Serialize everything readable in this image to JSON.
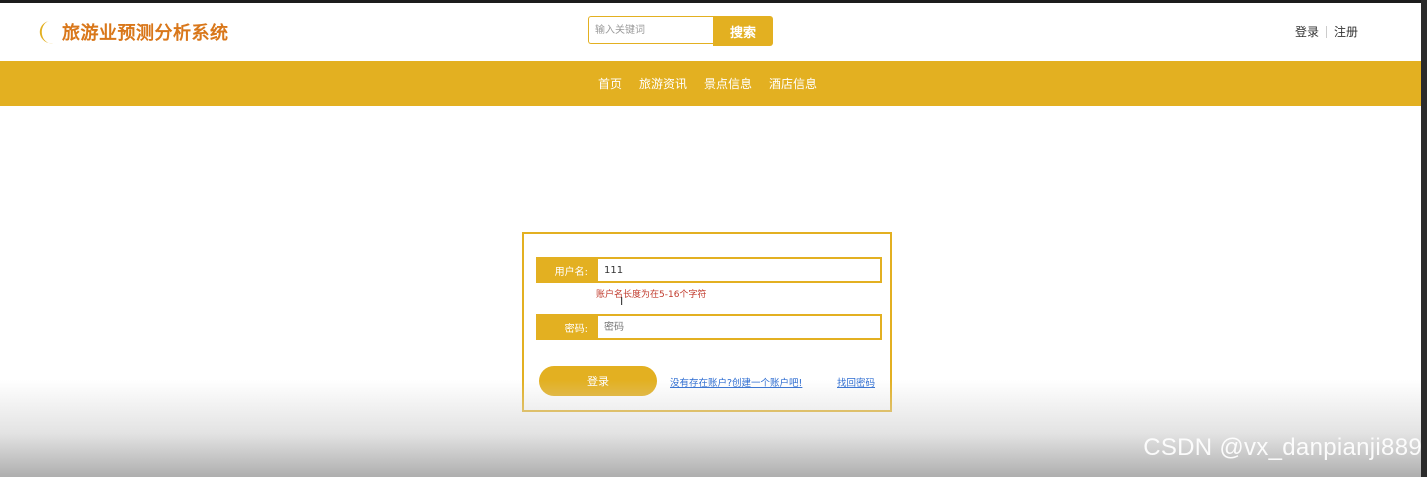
{
  "header": {
    "logo_icon": "crescent-moon-icon",
    "title": "旅游业预测分析系统",
    "search": {
      "placeholder": "输入关键词",
      "button": "搜索"
    },
    "login_link": "登录",
    "register_link": "注册"
  },
  "nav": {
    "items": [
      "首页",
      "旅游资讯",
      "景点信息",
      "酒店信息"
    ]
  },
  "login_form": {
    "username_label": "用户名:",
    "username_value": "111",
    "username_error": "账户名长度为在5-16个字符",
    "password_label": "密码:",
    "password_placeholder": "密码",
    "submit": "登录",
    "register_link": "没有存在账户?创建一个账户吧!",
    "forgot_link": "找回密码"
  },
  "watermark": "CSDN @vx_danpianji889",
  "colors": {
    "accent": "#e3b021",
    "logo_text": "#d9771a",
    "error": "#c0392b",
    "link": "#2b6bd1"
  }
}
